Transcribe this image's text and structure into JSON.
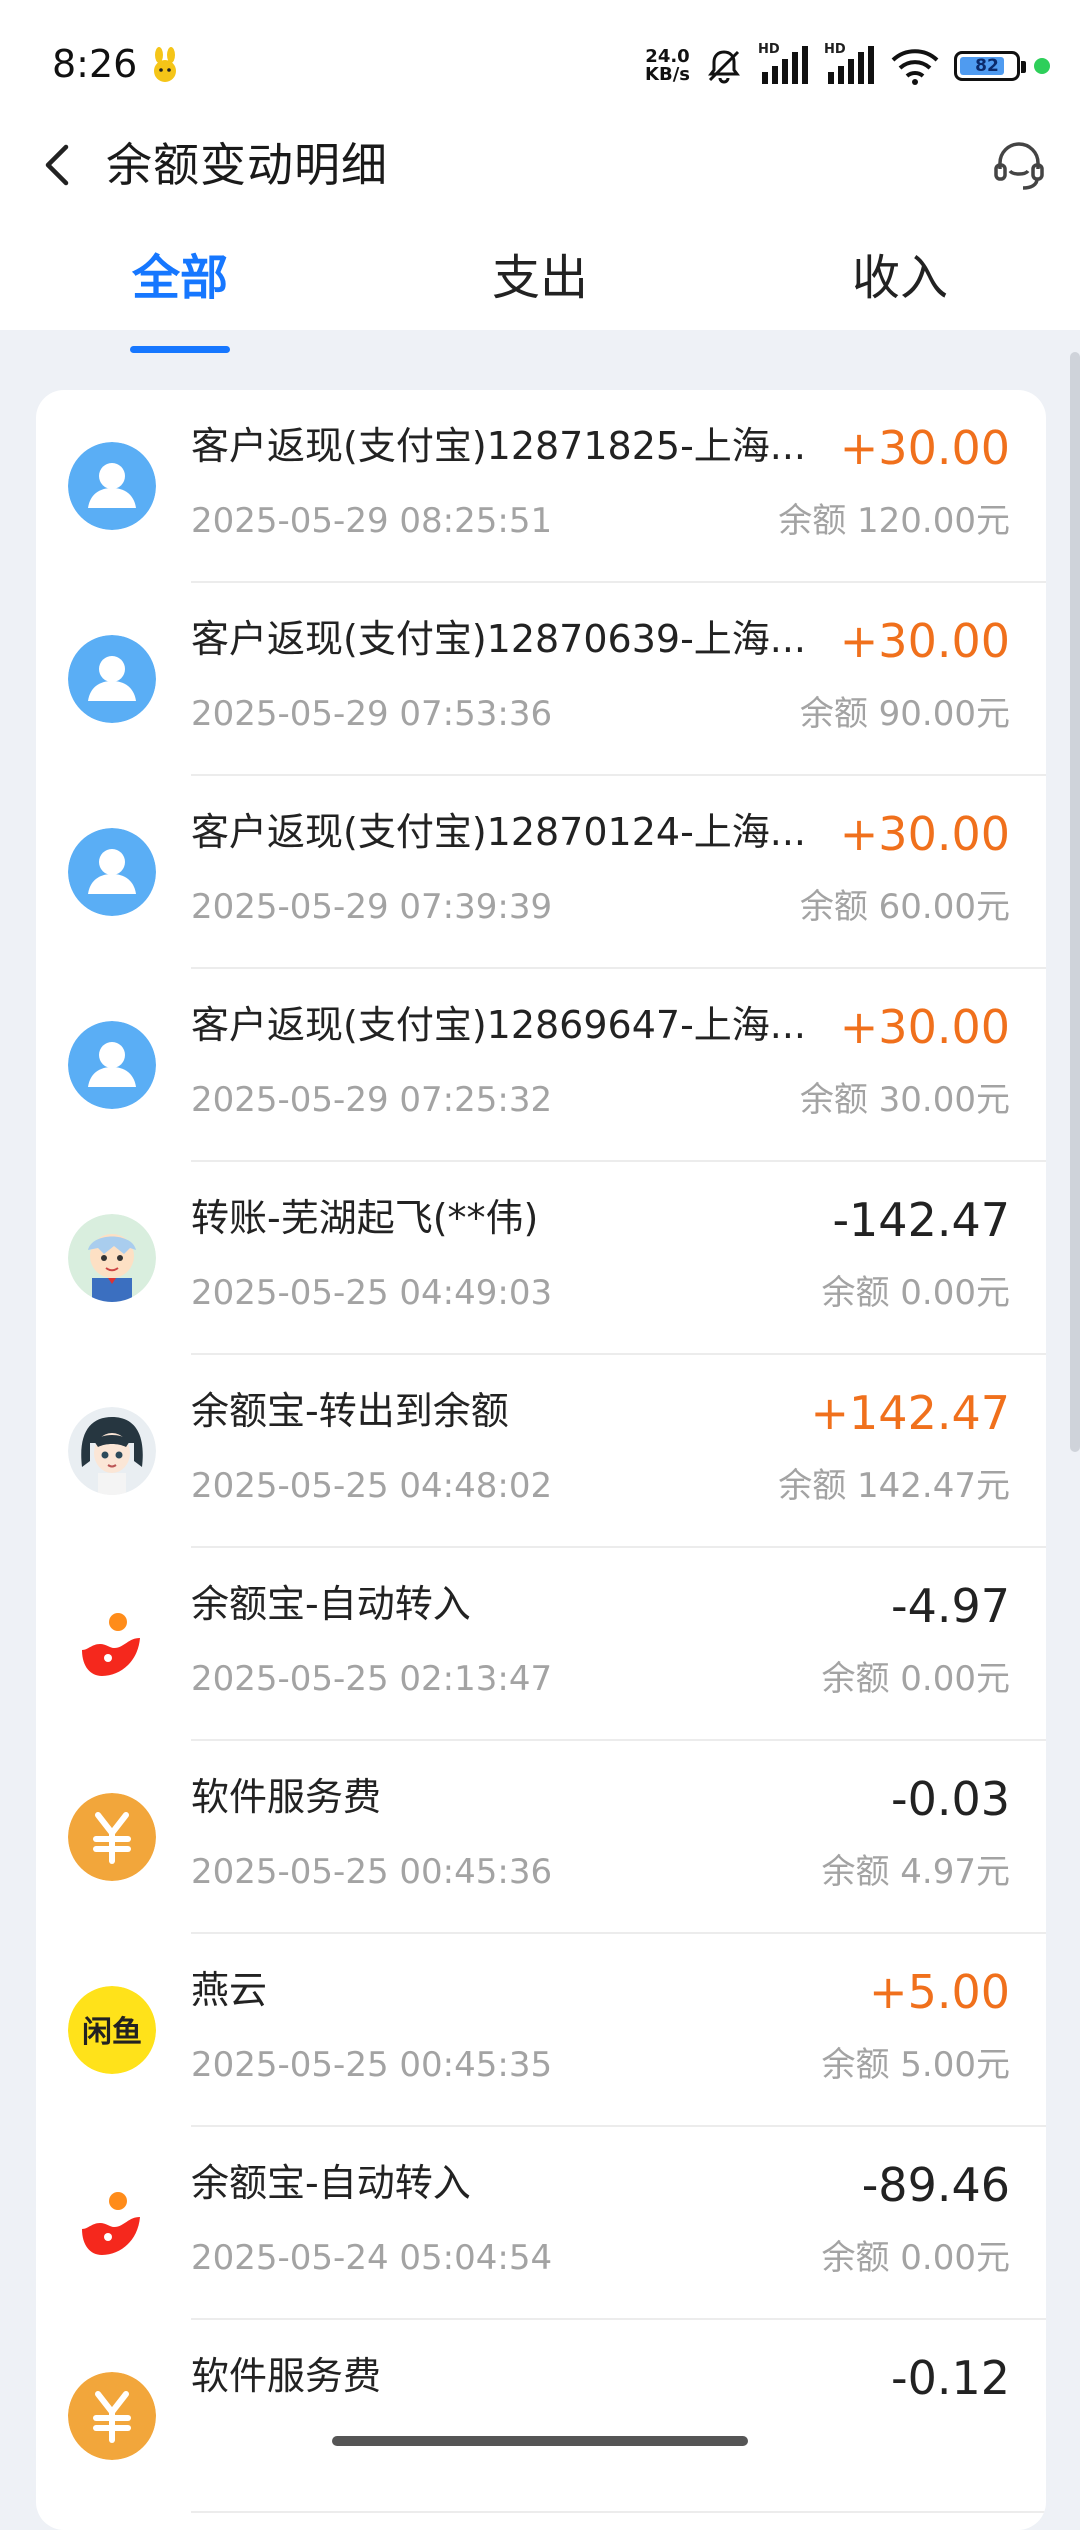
{
  "status": {
    "time": "8:26",
    "netspeed_value": "24.0",
    "netspeed_unit": "KB/s",
    "hd1": "HD",
    "hd2": "HD",
    "battery": "82",
    "battery_level": 0.82,
    "colors": {
      "battery_fill": "#4f9bf0",
      "indicator_dot": "#2ecf5a"
    }
  },
  "header": {
    "title": "余额变动明细",
    "back_icon": "back-chevron-icon",
    "service_icon": "customer-service-headset-icon"
  },
  "tabs": [
    {
      "label": "全部",
      "active": true
    },
    {
      "label": "支出",
      "active": false
    },
    {
      "label": "收入",
      "active": false
    }
  ],
  "colors": {
    "accent": "#1677ff",
    "income": "#f0701c",
    "expense": "#222222",
    "muted": "#a3a3a3"
  },
  "transactions": [
    {
      "title": "客户返现(支付宝)12871825-上海...",
      "time": "2025-05-29 08:25:51",
      "amount": "+30.00",
      "balance": "余额 120.00元",
      "avatar": "default-user-icon",
      "positive": true
    },
    {
      "title": "客户返现(支付宝)12870639-上海...",
      "time": "2025-05-29 07:53:36",
      "amount": "+30.00",
      "balance": "余额 90.00元",
      "avatar": "default-user-icon",
      "positive": true
    },
    {
      "title": "客户返现(支付宝)12870124-上海...",
      "time": "2025-05-29 07:39:39",
      "amount": "+30.00",
      "balance": "余额 60.00元",
      "avatar": "default-user-icon",
      "positive": true
    },
    {
      "title": "客户返现(支付宝)12869647-上海...",
      "time": "2025-05-29 07:25:32",
      "amount": "+30.00",
      "balance": "余额 30.00元",
      "avatar": "default-user-icon",
      "positive": true
    },
    {
      "title": "转账-芜湖起飞(**伟)",
      "time": "2025-05-25 04:49:03",
      "amount": "-142.47",
      "balance": "余额 0.00元",
      "avatar": "cartoon-avatar-icon",
      "positive": false
    },
    {
      "title": "余额宝-转出到余额",
      "time": "2025-05-25 04:48:02",
      "amount": "+142.47",
      "balance": "余额 142.47元",
      "avatar": "anime-avatar-icon",
      "positive": true
    },
    {
      "title": "余额宝-自动转入",
      "time": "2025-05-25 02:13:47",
      "amount": "-4.97",
      "balance": "余额 0.00元",
      "avatar": "yuebao-logo-icon",
      "positive": false
    },
    {
      "title": "软件服务费",
      "time": "2025-05-25 00:45:36",
      "amount": "-0.03",
      "balance": "余额 4.97元",
      "avatar": "yuan-coin-icon",
      "positive": false
    },
    {
      "title": "燕云",
      "time": "2025-05-25 00:45:35",
      "amount": "+5.00",
      "balance": "余额 5.00元",
      "avatar": "xianyu-logo-icon",
      "avatar_text": "闲鱼",
      "positive": true
    },
    {
      "title": "余额宝-自动转入",
      "time": "2025-05-24 05:04:54",
      "amount": "-89.46",
      "balance": "余额 0.00元",
      "avatar": "yuebao-logo-icon",
      "positive": false
    },
    {
      "title": "软件服务费",
      "time": "",
      "amount": "-0.12",
      "balance": "",
      "avatar": "yuan-coin-icon",
      "positive": false
    }
  ]
}
